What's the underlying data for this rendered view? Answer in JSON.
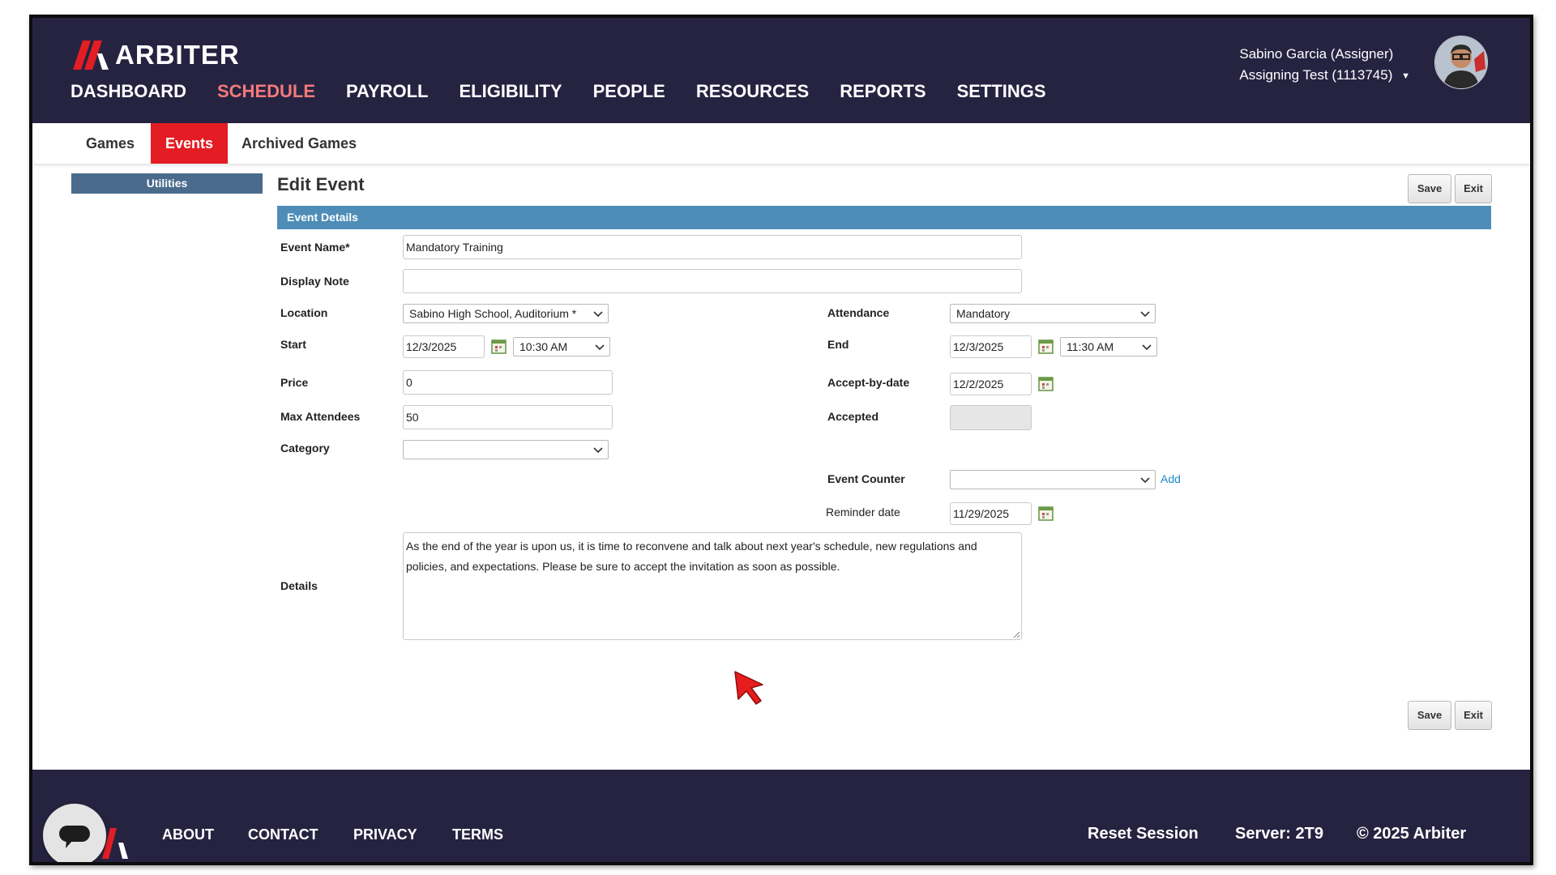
{
  "brand": {
    "name": "ARBITER",
    "accent": "#e31d23",
    "nav_bg": "#262341"
  },
  "header": {
    "nav": [
      {
        "label": "DASHBOARD",
        "active": false
      },
      {
        "label": "SCHEDULE",
        "active": true
      },
      {
        "label": "PAYROLL",
        "active": false
      },
      {
        "label": "ELIGIBILITY",
        "active": false
      },
      {
        "label": "PEOPLE",
        "active": false
      },
      {
        "label": "RESOURCES",
        "active": false
      },
      {
        "label": "REPORTS",
        "active": false
      },
      {
        "label": "SETTINGS",
        "active": false
      }
    ],
    "user": {
      "name": "Sabino Garcia (Assigner)",
      "account": "Assigning Test (1113745)"
    }
  },
  "subnav": {
    "tabs": [
      {
        "label": "Games",
        "active": false
      },
      {
        "label": "Events",
        "active": true
      },
      {
        "label": "Archived Games",
        "active": false
      }
    ]
  },
  "sidebar": {
    "utilities_label": "Utilities"
  },
  "page": {
    "title": "Edit Event",
    "save_label": "Save",
    "exit_label": "Exit",
    "section_title": "Event Details"
  },
  "form": {
    "event_name": {
      "label": "Event Name*",
      "value": "Mandatory Training"
    },
    "display_note": {
      "label": "Display Note",
      "value": ""
    },
    "location": {
      "label": "Location",
      "value": "Sabino High School, Auditorium *"
    },
    "attendance": {
      "label": "Attendance",
      "value": "Mandatory"
    },
    "start": {
      "label": "Start",
      "date": "12/3/2025",
      "time": "10:30 AM"
    },
    "end": {
      "label": "End",
      "date": "12/3/2025",
      "time": "11:30 AM"
    },
    "price": {
      "label": "Price",
      "value": "0"
    },
    "accept_by_date": {
      "label": "Accept-by-date",
      "value": "12/2/2025"
    },
    "max_attendees": {
      "label": "Max Attendees",
      "value": "50"
    },
    "accepted": {
      "label": "Accepted",
      "value": ""
    },
    "category": {
      "label": "Category",
      "value": ""
    },
    "event_counter": {
      "label": "Event Counter",
      "value": "",
      "add_label": "Add"
    },
    "reminder_date": {
      "label": "Reminder date",
      "value": "11/29/2025"
    },
    "details": {
      "label": "Details",
      "value": "As the end of the year is upon us, it is time to reconvene and talk about next year's schedule, new regulations and policies, and expectations. Please be sure to accept the invitation as soon as possible."
    }
  },
  "footer": {
    "links": [
      "ABOUT",
      "CONTACT",
      "PRIVACY",
      "TERMS"
    ],
    "reset_session": "Reset Session",
    "server": "Server: 2T9",
    "copyright": "© 2025 Arbiter"
  },
  "icons": {
    "logo": "arbiter-logo-icon",
    "calendar": "calendar-icon",
    "chevron": "chevron-down-icon",
    "caret": "caret-down-icon",
    "chat": "chat-icon",
    "cursor": "mouse-cursor-icon"
  }
}
